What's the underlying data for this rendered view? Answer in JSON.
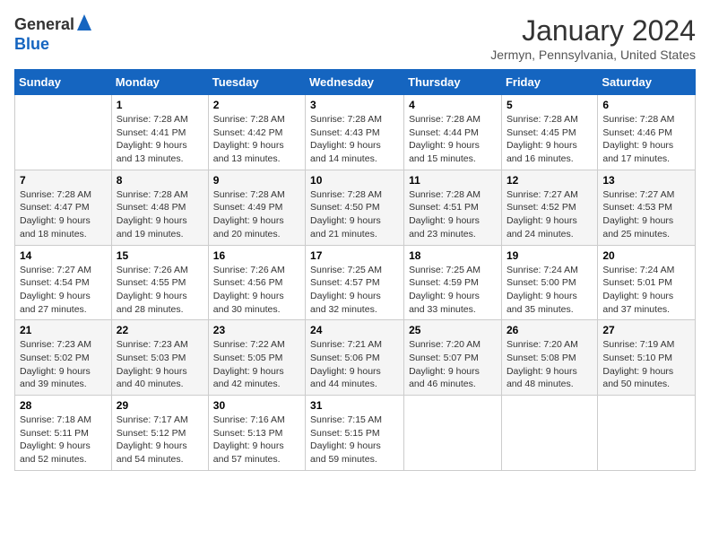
{
  "logo": {
    "general": "General",
    "blue": "Blue"
  },
  "title": "January 2024",
  "location": "Jermyn, Pennsylvania, United States",
  "days_of_week": [
    "Sunday",
    "Monday",
    "Tuesday",
    "Wednesday",
    "Thursday",
    "Friday",
    "Saturday"
  ],
  "weeks": [
    [
      {
        "day": "",
        "sunrise": "",
        "sunset": "",
        "daylight": ""
      },
      {
        "day": "1",
        "sunrise": "Sunrise: 7:28 AM",
        "sunset": "Sunset: 4:41 PM",
        "daylight": "Daylight: 9 hours and 13 minutes."
      },
      {
        "day": "2",
        "sunrise": "Sunrise: 7:28 AM",
        "sunset": "Sunset: 4:42 PM",
        "daylight": "Daylight: 9 hours and 13 minutes."
      },
      {
        "day": "3",
        "sunrise": "Sunrise: 7:28 AM",
        "sunset": "Sunset: 4:43 PM",
        "daylight": "Daylight: 9 hours and 14 minutes."
      },
      {
        "day": "4",
        "sunrise": "Sunrise: 7:28 AM",
        "sunset": "Sunset: 4:44 PM",
        "daylight": "Daylight: 9 hours and 15 minutes."
      },
      {
        "day": "5",
        "sunrise": "Sunrise: 7:28 AM",
        "sunset": "Sunset: 4:45 PM",
        "daylight": "Daylight: 9 hours and 16 minutes."
      },
      {
        "day": "6",
        "sunrise": "Sunrise: 7:28 AM",
        "sunset": "Sunset: 4:46 PM",
        "daylight": "Daylight: 9 hours and 17 minutes."
      }
    ],
    [
      {
        "day": "7",
        "sunrise": "Sunrise: 7:28 AM",
        "sunset": "Sunset: 4:47 PM",
        "daylight": "Daylight: 9 hours and 18 minutes."
      },
      {
        "day": "8",
        "sunrise": "Sunrise: 7:28 AM",
        "sunset": "Sunset: 4:48 PM",
        "daylight": "Daylight: 9 hours and 19 minutes."
      },
      {
        "day": "9",
        "sunrise": "Sunrise: 7:28 AM",
        "sunset": "Sunset: 4:49 PM",
        "daylight": "Daylight: 9 hours and 20 minutes."
      },
      {
        "day": "10",
        "sunrise": "Sunrise: 7:28 AM",
        "sunset": "Sunset: 4:50 PM",
        "daylight": "Daylight: 9 hours and 21 minutes."
      },
      {
        "day": "11",
        "sunrise": "Sunrise: 7:28 AM",
        "sunset": "Sunset: 4:51 PM",
        "daylight": "Daylight: 9 hours and 23 minutes."
      },
      {
        "day": "12",
        "sunrise": "Sunrise: 7:27 AM",
        "sunset": "Sunset: 4:52 PM",
        "daylight": "Daylight: 9 hours and 24 minutes."
      },
      {
        "day": "13",
        "sunrise": "Sunrise: 7:27 AM",
        "sunset": "Sunset: 4:53 PM",
        "daylight": "Daylight: 9 hours and 25 minutes."
      }
    ],
    [
      {
        "day": "14",
        "sunrise": "Sunrise: 7:27 AM",
        "sunset": "Sunset: 4:54 PM",
        "daylight": "Daylight: 9 hours and 27 minutes."
      },
      {
        "day": "15",
        "sunrise": "Sunrise: 7:26 AM",
        "sunset": "Sunset: 4:55 PM",
        "daylight": "Daylight: 9 hours and 28 minutes."
      },
      {
        "day": "16",
        "sunrise": "Sunrise: 7:26 AM",
        "sunset": "Sunset: 4:56 PM",
        "daylight": "Daylight: 9 hours and 30 minutes."
      },
      {
        "day": "17",
        "sunrise": "Sunrise: 7:25 AM",
        "sunset": "Sunset: 4:57 PM",
        "daylight": "Daylight: 9 hours and 32 minutes."
      },
      {
        "day": "18",
        "sunrise": "Sunrise: 7:25 AM",
        "sunset": "Sunset: 4:59 PM",
        "daylight": "Daylight: 9 hours and 33 minutes."
      },
      {
        "day": "19",
        "sunrise": "Sunrise: 7:24 AM",
        "sunset": "Sunset: 5:00 PM",
        "daylight": "Daylight: 9 hours and 35 minutes."
      },
      {
        "day": "20",
        "sunrise": "Sunrise: 7:24 AM",
        "sunset": "Sunset: 5:01 PM",
        "daylight": "Daylight: 9 hours and 37 minutes."
      }
    ],
    [
      {
        "day": "21",
        "sunrise": "Sunrise: 7:23 AM",
        "sunset": "Sunset: 5:02 PM",
        "daylight": "Daylight: 9 hours and 39 minutes."
      },
      {
        "day": "22",
        "sunrise": "Sunrise: 7:23 AM",
        "sunset": "Sunset: 5:03 PM",
        "daylight": "Daylight: 9 hours and 40 minutes."
      },
      {
        "day": "23",
        "sunrise": "Sunrise: 7:22 AM",
        "sunset": "Sunset: 5:05 PM",
        "daylight": "Daylight: 9 hours and 42 minutes."
      },
      {
        "day": "24",
        "sunrise": "Sunrise: 7:21 AM",
        "sunset": "Sunset: 5:06 PM",
        "daylight": "Daylight: 9 hours and 44 minutes."
      },
      {
        "day": "25",
        "sunrise": "Sunrise: 7:20 AM",
        "sunset": "Sunset: 5:07 PM",
        "daylight": "Daylight: 9 hours and 46 minutes."
      },
      {
        "day": "26",
        "sunrise": "Sunrise: 7:20 AM",
        "sunset": "Sunset: 5:08 PM",
        "daylight": "Daylight: 9 hours and 48 minutes."
      },
      {
        "day": "27",
        "sunrise": "Sunrise: 7:19 AM",
        "sunset": "Sunset: 5:10 PM",
        "daylight": "Daylight: 9 hours and 50 minutes."
      }
    ],
    [
      {
        "day": "28",
        "sunrise": "Sunrise: 7:18 AM",
        "sunset": "Sunset: 5:11 PM",
        "daylight": "Daylight: 9 hours and 52 minutes."
      },
      {
        "day": "29",
        "sunrise": "Sunrise: 7:17 AM",
        "sunset": "Sunset: 5:12 PM",
        "daylight": "Daylight: 9 hours and 54 minutes."
      },
      {
        "day": "30",
        "sunrise": "Sunrise: 7:16 AM",
        "sunset": "Sunset: 5:13 PM",
        "daylight": "Daylight: 9 hours and 57 minutes."
      },
      {
        "day": "31",
        "sunrise": "Sunrise: 7:15 AM",
        "sunset": "Sunset: 5:15 PM",
        "daylight": "Daylight: 9 hours and 59 minutes."
      },
      {
        "day": "",
        "sunrise": "",
        "sunset": "",
        "daylight": ""
      },
      {
        "day": "",
        "sunrise": "",
        "sunset": "",
        "daylight": ""
      },
      {
        "day": "",
        "sunrise": "",
        "sunset": "",
        "daylight": ""
      }
    ]
  ]
}
